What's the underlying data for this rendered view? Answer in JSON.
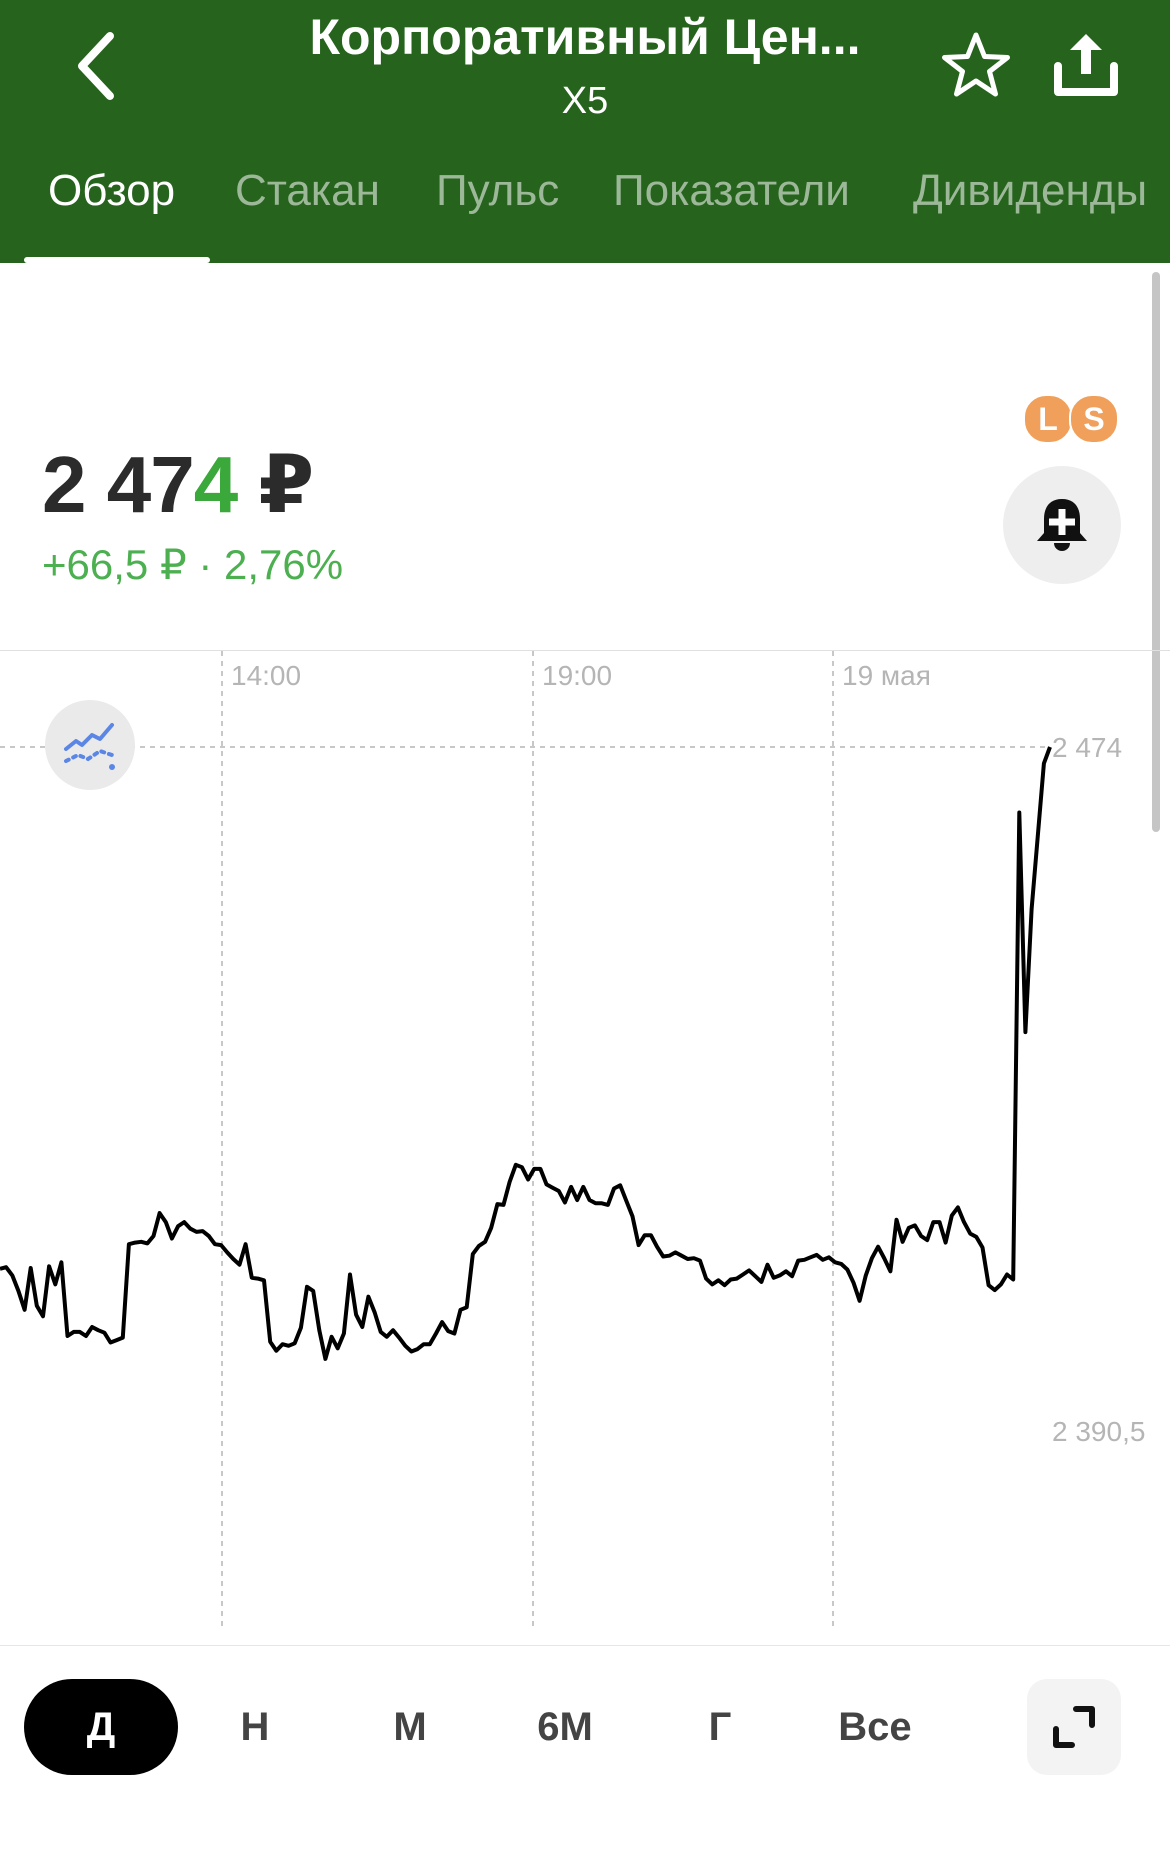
{
  "header": {
    "title": "Корпоративный Цен...",
    "ticker": "X5",
    "tabs": [
      {
        "label": "Обзор",
        "active": true
      },
      {
        "label": "Стакан",
        "active": false
      },
      {
        "label": "Пульс",
        "active": false
      },
      {
        "label": "Показатели",
        "active": false
      },
      {
        "label": "Дивиденды",
        "active": false
      }
    ],
    "icons": [
      "chevron-left-icon",
      "star-icon",
      "share-icon"
    ],
    "bg_color": "#26631d"
  },
  "quote": {
    "price_main": "2 47",
    "price_last_digit": "4",
    "currency": "₽",
    "change": "+66,5 ₽ · 2,76%",
    "change_color": "#4caf50",
    "badges": [
      "L",
      "S"
    ],
    "alert_icon": "bell-plus-icon"
  },
  "chart_data": {
    "type": "line",
    "x_ticks": [
      "14:00",
      "19:00",
      "19 мая"
    ],
    "y_top_label": "2 474",
    "y_bottom_label": "2 390,5",
    "ylim": [
      2390.5,
      2474
    ],
    "current_value": 2474,
    "grid": "vertical dashed",
    "y": [
      2410.3,
      2410.5,
      2409.5,
      2407.6,
      2405.3,
      2410.4,
      2405.8,
      2404.5,
      2410.6,
      2408.4,
      2411.1,
      2402.1,
      2402.6,
      2402.6,
      2402.1,
      2403.2,
      2402.8,
      2402.5,
      2401.3,
      2401.6,
      2401.9,
      2413.3,
      2413.5,
      2413.6,
      2413.4,
      2414.3,
      2417.1,
      2416.0,
      2414.0,
      2415.5,
      2416.0,
      2415.2,
      2414.8,
      2414.9,
      2414.3,
      2413.3,
      2413.2,
      2412.3,
      2411.5,
      2410.8,
      2413.3,
      2409.2,
      2409.1,
      2408.9,
      2401.4,
      2400.3,
      2401.1,
      2400.9,
      2401.2,
      2403.1,
      2408.1,
      2407.6,
      2402.8,
      2399.3,
      2402.0,
      2400.6,
      2402.4,
      2409.6,
      2404.7,
      2403.2,
      2406.9,
      2405.0,
      2402.6,
      2402.0,
      2402.8,
      2401.9,
      2400.9,
      2400.2,
      2400.5,
      2401.1,
      2401.1,
      2402.4,
      2403.8,
      2402.7,
      2402.4,
      2405.3,
      2405.6,
      2412.1,
      2413.1,
      2413.6,
      2415.3,
      2418.2,
      2418.1,
      2420.9,
      2423.0,
      2422.7,
      2421.2,
      2422.5,
      2422.5,
      2420.6,
      2420.2,
      2419.8,
      2418.4,
      2420.3,
      2418.7,
      2420.3,
      2418.7,
      2418.3,
      2418.3,
      2418.1,
      2420.1,
      2420.5,
      2418.6,
      2416.7,
      2413.2,
      2414.4,
      2414.4,
      2413.0,
      2411.8,
      2411.9,
      2412.3,
      2411.9,
      2411.5,
      2411.6,
      2411.3,
      2409.1,
      2408.4,
      2408.9,
      2408.3,
      2409.0,
      2409.1,
      2409.6,
      2410.1,
      2409.4,
      2408.7,
      2410.8,
      2409.2,
      2409.5,
      2410.0,
      2409.4,
      2411.3,
      2411.4,
      2411.7,
      2412.0,
      2411.4,
      2411.7,
      2411.1,
      2410.9,
      2410.2,
      2408.6,
      2406.4,
      2409.5,
      2411.6,
      2413.0,
      2411.6,
      2410.0,
      2416.3,
      2413.6,
      2415.3,
      2415.6,
      2414.3,
      2413.8,
      2416.0,
      2416.0,
      2413.5,
      2416.8,
      2417.8,
      2416.0,
      2414.6,
      2414.2,
      2412.9,
      2408.3,
      2407.7,
      2408.4,
      2409.6,
      2409.0,
      2466.0,
      2439.2,
      2454.2,
      2463.0,
      2472.0,
      2474.0
    ]
  },
  "periods": [
    {
      "label": "Д",
      "active": true
    },
    {
      "label": "Н",
      "active": false
    },
    {
      "label": "М",
      "active": false
    },
    {
      "label": "6М",
      "active": false
    },
    {
      "label": "Г",
      "active": false
    },
    {
      "label": "Все",
      "active": false
    }
  ],
  "bottom_icons": [
    "expand-icon"
  ]
}
